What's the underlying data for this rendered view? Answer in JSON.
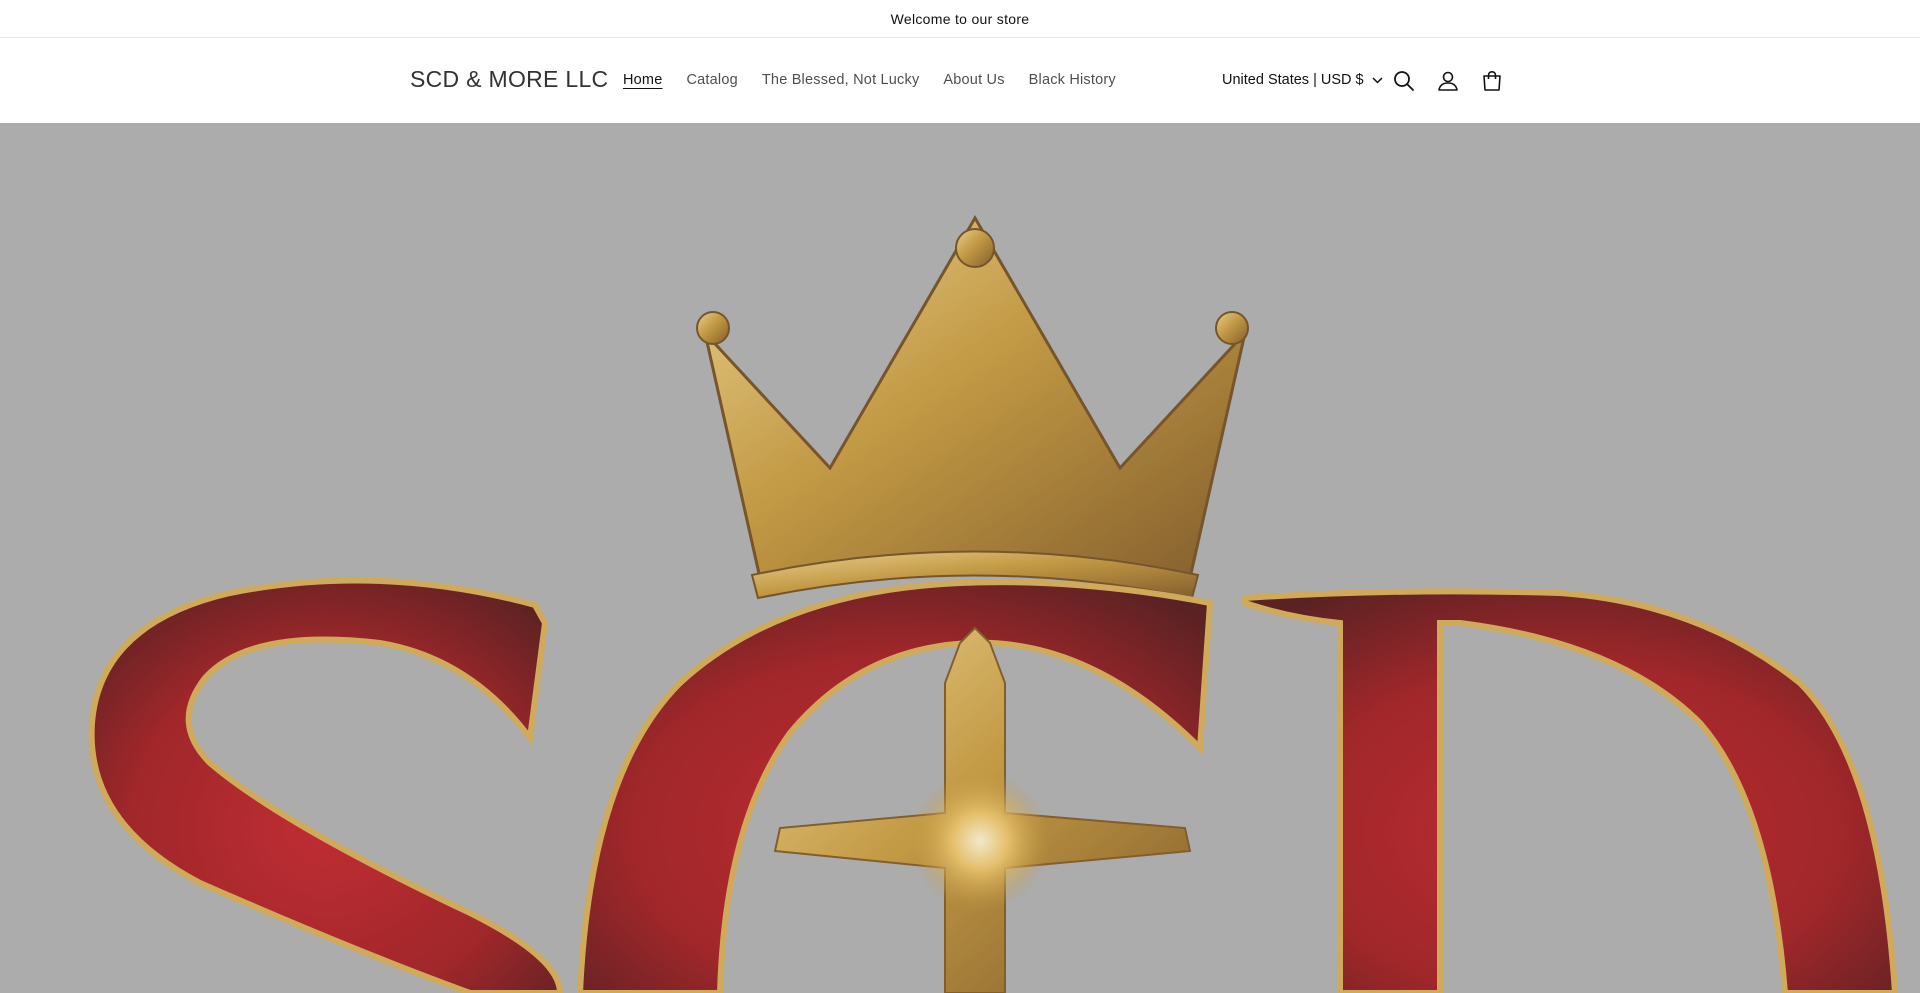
{
  "announcement": {
    "text": "Welcome to our store"
  },
  "header": {
    "store_name": "SCD & MORE LLC",
    "nav": [
      {
        "label": "Home",
        "active": true
      },
      {
        "label": "Catalog",
        "active": false
      },
      {
        "label": "The Blessed, Not Lucky",
        "active": false
      },
      {
        "label": "About Us",
        "active": false
      },
      {
        "label": "Black History",
        "active": false
      }
    ],
    "country_selector": "United States | USD $",
    "icons": [
      "search-icon",
      "account-icon",
      "cart-icon"
    ]
  },
  "hero": {
    "image": "SCD crown and cross logo",
    "overlay_color": "#acacac",
    "colors": {
      "gold": "#c8962e",
      "red": "#9e0a0e",
      "dark_red": "#4a0406"
    }
  }
}
